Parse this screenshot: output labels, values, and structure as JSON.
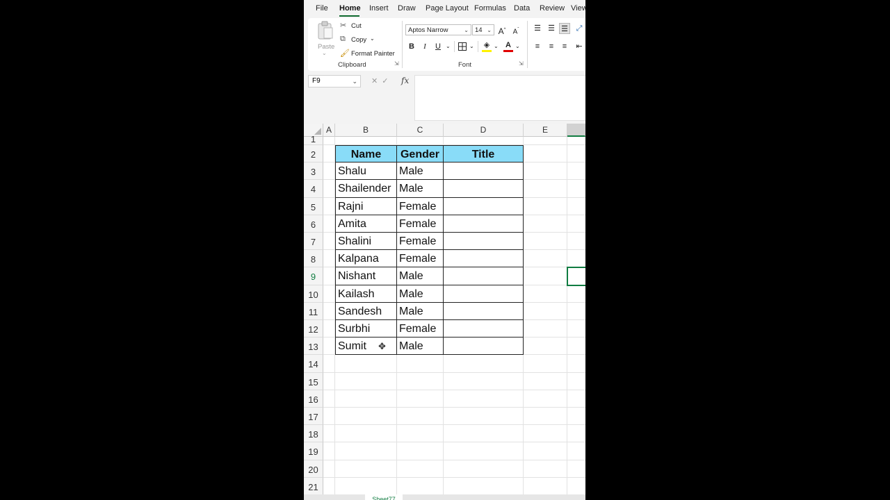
{
  "menu": {
    "tabs": [
      "File",
      "Home",
      "Insert",
      "Draw",
      "Page Layout",
      "Formulas",
      "Data",
      "Review",
      "View"
    ],
    "active": "Home"
  },
  "ribbon": {
    "clipboard": {
      "paste": "Paste",
      "cut": "Cut",
      "copy": "Copy",
      "format_painter": "Format Painter",
      "group_label": "Clipboard"
    },
    "font": {
      "font_name": "Aptos Narrow",
      "font_size": "14",
      "bold": "B",
      "italic": "I",
      "underline": "U",
      "grow": "A",
      "shrink": "A",
      "group_label": "Font"
    }
  },
  "formula_bar": {
    "name_box": "F9",
    "fx": "fx",
    "content": ""
  },
  "grid": {
    "columns": [
      "A",
      "B",
      "C",
      "D",
      "E"
    ],
    "rows": [
      "1",
      "2",
      "3",
      "4",
      "5",
      "6",
      "7",
      "8",
      "9",
      "10",
      "11",
      "12",
      "13",
      "14",
      "15",
      "16",
      "17",
      "18",
      "19",
      "20",
      "21"
    ],
    "selected_row": "9",
    "table_headers": [
      "Name",
      "Gender",
      "Title"
    ],
    "table_rows": [
      [
        "Shalu",
        "Male",
        ""
      ],
      [
        "Shailender",
        "Male",
        ""
      ],
      [
        "Rajni",
        "Female",
        ""
      ],
      [
        "Amita",
        "Female",
        ""
      ],
      [
        "Shalini",
        "Female",
        ""
      ],
      [
        "Kalpana",
        "Female",
        ""
      ],
      [
        "Nishant",
        "Male",
        ""
      ],
      [
        "Kailash",
        "Male",
        ""
      ],
      [
        "Sandesh",
        "Male",
        ""
      ],
      [
        "Surbhi",
        "Female",
        ""
      ],
      [
        "Sumit",
        "Male",
        ""
      ]
    ]
  },
  "colors": {
    "header_fill": "#89dcf8",
    "accent": "#107c41"
  },
  "sheet": {
    "tab": "Sheet77"
  }
}
